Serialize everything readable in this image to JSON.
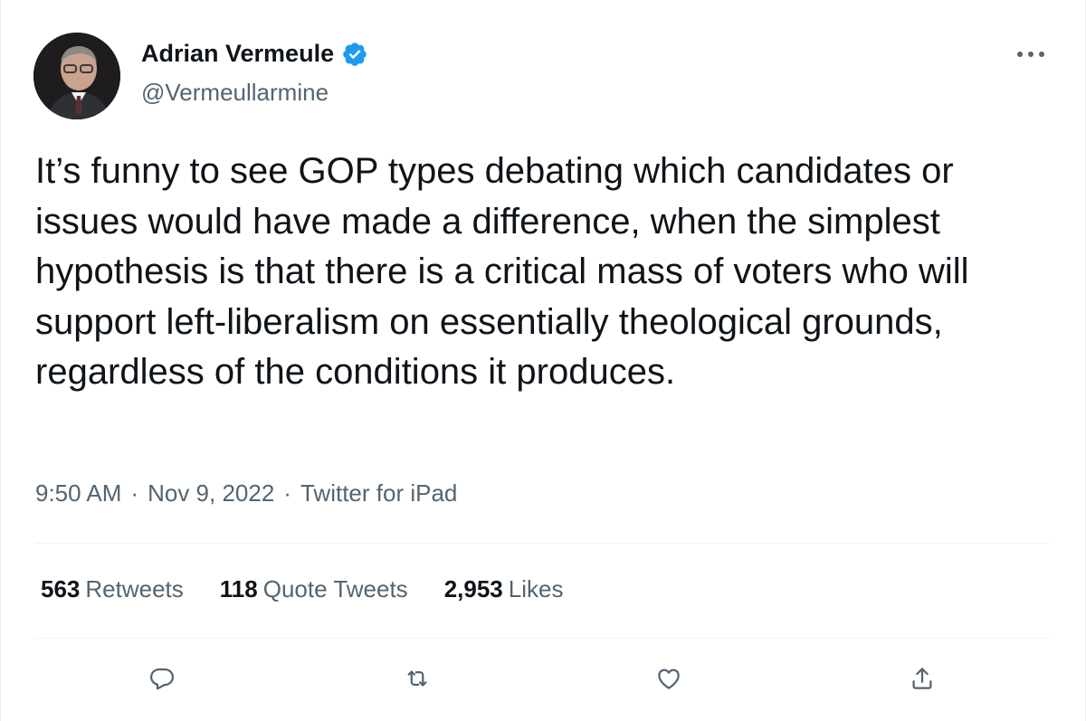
{
  "author": {
    "display_name": "Adrian Vermeule",
    "handle": "@Vermeullarmine",
    "verified_icon": "verified-badge-icon",
    "avatar": "profile-photo"
  },
  "tweet": {
    "text": "It’s funny to see GOP types debating which candidates or issues would have made a difference, when the simplest hypothesis is that there is a critical mass of voters who will support left-liberalism on essentially theological grounds, regardless of the conditions it produces.",
    "time": "9:50 AM",
    "date": "Nov 9, 2022",
    "source": "Twitter for iPad",
    "separator": "·"
  },
  "stats": {
    "retweets": {
      "count": "563",
      "label": "Retweets"
    },
    "quotes": {
      "count": "118",
      "label": "Quote Tweets"
    },
    "likes": {
      "count": "2,953",
      "label": "Likes"
    }
  },
  "actions": [
    "reply-icon",
    "retweet-icon",
    "like-icon",
    "share-icon"
  ],
  "colors": {
    "text": "#0f1419",
    "secondary": "#536471",
    "verified": "#1d9bf0",
    "divider": "#eff3f4"
  }
}
